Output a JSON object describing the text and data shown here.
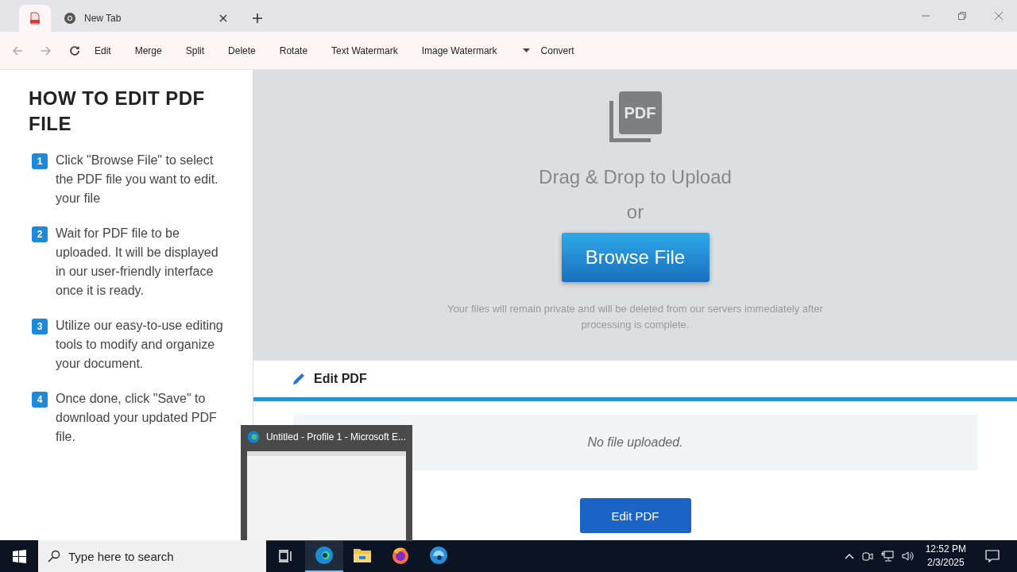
{
  "browser": {
    "tabs": [
      {
        "kind": "pdf",
        "selected": true
      },
      {
        "kind": "web",
        "title": "New Tab",
        "selected": false
      }
    ],
    "menu": [
      "Edit",
      "Merge",
      "Split",
      "Delete",
      "Rotate",
      "Text Watermark",
      "Image Watermark"
    ],
    "dropdown_menu": "Convert"
  },
  "guide": {
    "title": "HOW TO EDIT PDF FILE",
    "steps": [
      {
        "number": "1",
        "text": "Click \"Browse File\" to select the PDF file you want to edit. your file"
      },
      {
        "number": "2",
        "text": "Wait for PDF file to be uploaded. It will be displayed in our user-friendly interface once it is ready."
      },
      {
        "number": "3",
        "text": "Utilize our easy-to-use editing tools to modify and organize your document."
      },
      {
        "number": "4",
        "text": "Once done, click \"Save\" to download your updated PDF file."
      }
    ]
  },
  "upload": {
    "icon_text": "PDF",
    "heading": "Drag & Drop to Upload",
    "or": "or",
    "button": "Browse File",
    "note": "Your files will remain private and will be deleted from our servers immediately after processing is complete."
  },
  "editor": {
    "title": "Edit PDF",
    "status": "No file uploaded.",
    "button": "Edit PDF"
  },
  "preview": {
    "title": "Untitled - Profile 1 - Microsoft E..."
  },
  "taskbar": {
    "search_placeholder": "Type here to search",
    "apps": [
      {
        "kind": "edge",
        "selected": true
      },
      {
        "kind": "folder",
        "selected": false
      },
      {
        "kind": "firefox",
        "selected": false
      },
      {
        "kind": "edge-dev",
        "selected": false
      }
    ],
    "time": "12:52 PM",
    "date": "2/3/2025"
  }
}
